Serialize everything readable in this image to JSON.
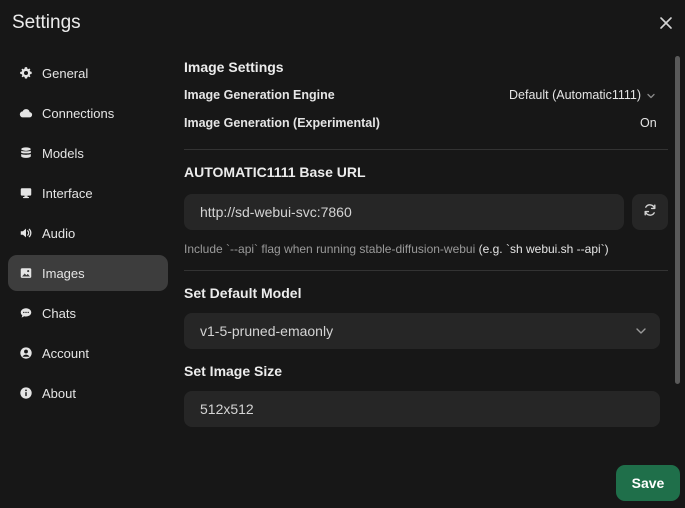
{
  "dialog": {
    "title": "Settings"
  },
  "sidebar": {
    "items": [
      {
        "label": "General",
        "icon": "gear-icon"
      },
      {
        "label": "Connections",
        "icon": "cloud-icon"
      },
      {
        "label": "Models",
        "icon": "database-icon"
      },
      {
        "label": "Interface",
        "icon": "monitor-icon"
      },
      {
        "label": "Audio",
        "icon": "speaker-icon"
      },
      {
        "label": "Images",
        "icon": "image-icon",
        "active": true
      },
      {
        "label": "Chats",
        "icon": "chat-bubble-icon"
      },
      {
        "label": "Account",
        "icon": "user-circle-icon"
      },
      {
        "label": "About",
        "icon": "info-icon"
      }
    ]
  },
  "image_settings": {
    "heading": "Image Settings",
    "engine_label": "Image Generation Engine",
    "engine_value": "Default (Automatic1111)",
    "experimental_label": "Image Generation (Experimental)",
    "experimental_value": "On"
  },
  "base_url": {
    "heading": "AUTOMATIC1111 Base URL",
    "value": "http://sd-webui-svc:7860",
    "hint_prefix": "Include `--api` flag when running stable-diffusion-webui",
    "hint_example": "(e.g. `sh webui.sh --api`)"
  },
  "default_model": {
    "heading": "Set Default Model",
    "value": "v1-5-pruned-emaonly"
  },
  "image_size": {
    "heading": "Set Image Size",
    "value": "512x512"
  },
  "footer": {
    "save_label": "Save"
  },
  "colors": {
    "background": "#171717",
    "active_nav": "#3d3d3d",
    "field_bg": "#262626",
    "save_bg": "#1f6f4a"
  }
}
